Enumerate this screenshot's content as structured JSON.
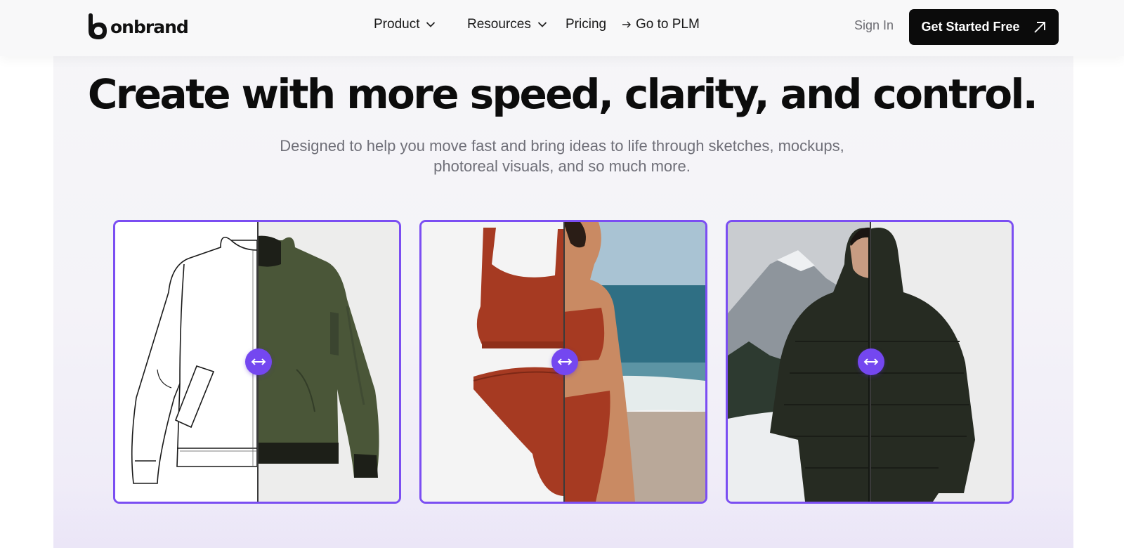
{
  "brand": {
    "name": "onbrand"
  },
  "nav": {
    "items": [
      {
        "label": "Product",
        "has_dropdown": true
      },
      {
        "label": "Resources",
        "has_dropdown": true
      },
      {
        "label": "Pricing",
        "has_dropdown": false
      },
      {
        "label": "Go to PLM",
        "icon": "arrow-right-icon"
      }
    ],
    "sign_in": "Sign In",
    "cta": {
      "label": "Get Started Free",
      "icon": "arrow-up-right-icon"
    }
  },
  "hero": {
    "title": "Create with more speed, clarity, and control.",
    "subtitle_line1": "Designed to help you move fast and bring ideas to life through sketches, mockups,",
    "subtitle_line2": "photoreal visuals, and so much more."
  },
  "cards": [
    {
      "name": "bomber-jacket",
      "left_image": "flat sketch",
      "right_image": "olive jacket render",
      "handle_icon": "arrow-left-right-icon"
    },
    {
      "name": "bikini",
      "left_image": "product mockup",
      "right_image": "beach photoreal",
      "handle_icon": "arrow-left-right-icon"
    },
    {
      "name": "puffer-jacket",
      "left_image": "mountain photo",
      "right_image": "studio photo",
      "handle_icon": "arrow-left-right-icon"
    }
  ],
  "colors": {
    "accent": "#7b4ef2",
    "cta_bg": "#0b0b0b",
    "subtitle_text": "#6f6f78",
    "jacket_olive": "#4a5638",
    "bikini_rust": "#a63a22",
    "puffer_dark": "#262b22"
  }
}
